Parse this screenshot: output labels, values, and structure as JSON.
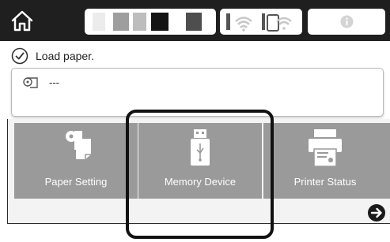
{
  "colors": {
    "topbar": "#1f1f1f",
    "tile": "#9a9a9a",
    "tile_text": "#ffffff",
    "highlight": "#111111"
  },
  "header": {
    "home_icon": "home-icon",
    "ink_levels": [
      "#ececec",
      "#9e9e9e",
      "#bdbdbd",
      "#141414",
      "#4e4e4e"
    ],
    "network_icons": [
      "wifi-icon",
      "wifi-direct-icon"
    ],
    "info_icon": "info-icon"
  },
  "status": {
    "icon": "check-circle-icon",
    "text": "Load paper."
  },
  "paper": {
    "icon": "roll-paper-icon",
    "value": "---"
  },
  "tiles": [
    {
      "label": "Paper Setting",
      "icon": "paper-setting-icon"
    },
    {
      "label": "Memory Device",
      "icon": "usb-drive-icon"
    },
    {
      "label": "Printer Status",
      "icon": "printer-icon"
    }
  ],
  "navigation": {
    "next_icon": "arrow-right-icon"
  }
}
